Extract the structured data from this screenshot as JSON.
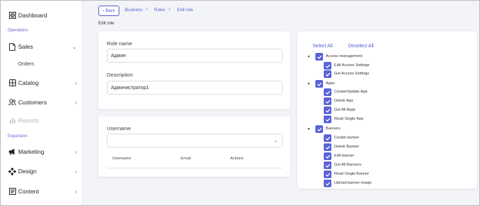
{
  "sidebar": {
    "dashboard": "Dashboard",
    "section_operations": "Operations",
    "sales": "Sales",
    "orders": "Orders",
    "catalog": "Catalog",
    "customers": "Customers",
    "reports": "Reports",
    "section_expansion": "Expansion",
    "marketing": "Marketing",
    "design": "Design",
    "content": "Content"
  },
  "breadcrumb": {
    "back": "Back",
    "items": [
      "Business",
      "Roles",
      "Edit role"
    ]
  },
  "page_title": "Edit role",
  "role_form": {
    "name_label": "Role name",
    "name_value": "Админ",
    "description_label": "Description",
    "description_value": "Администратор1"
  },
  "users_card": {
    "username_label": "Username",
    "columns": [
      "Username",
      "Email",
      "Actions"
    ]
  },
  "permissions": {
    "select_all": "Select All",
    "deselect_all": "Deselect All",
    "groups": [
      {
        "label": "Access management",
        "items": [
          "Edit Access Settings",
          "Get Access Settings"
        ]
      },
      {
        "label": "Apps",
        "items": [
          "Create/Update App",
          "Delete App",
          "Get All Apps",
          "Read Single App"
        ]
      },
      {
        "label": "Banners",
        "items": [
          "Create banner",
          "Delete Banner",
          "Edit banner",
          "Get All Banners",
          "Read Single Banner",
          "Upload banner image"
        ]
      }
    ]
  },
  "colors": {
    "accent": "#4f5bd5",
    "checkbox": "#5a63d8",
    "section": "#6d5fd4",
    "background": "#f3f4f8"
  }
}
